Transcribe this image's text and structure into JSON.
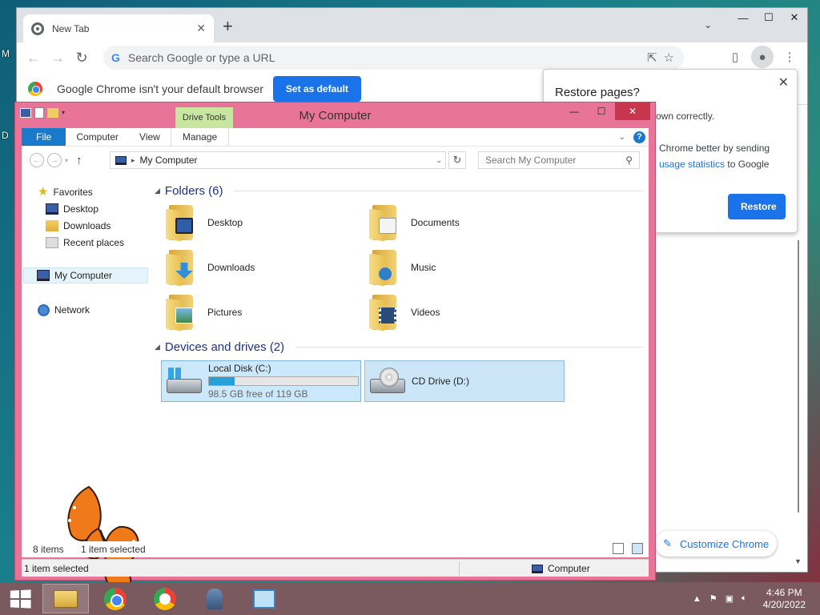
{
  "desktop": {
    "labels": [
      "M",
      "D"
    ]
  },
  "chrome": {
    "tab_title": "New Tab",
    "tab_close": "✕",
    "new_tab": "+",
    "tabstrip_menu": "⌄",
    "window_controls": [
      "—",
      "☐",
      "✕"
    ],
    "omnibox_g": "G",
    "omnibox_placeholder": "Search Google or type a URL",
    "infobar_message": "Google Chrome isn't your default browser",
    "set_default_label": "Set as default",
    "restore_popup": {
      "title": "Restore pages?",
      "close": "✕",
      "body_line1": "own correctly.",
      "body_line2a": "Chrome better by sending",
      "body_line2b_link": "usage statistics",
      "body_line2c": " to Google",
      "restore_label": "Restore"
    },
    "customize_label": "Customize Chrome"
  },
  "explorer": {
    "title": "My Computer",
    "context_tab": "Drive Tools",
    "ribbon_tabs": [
      "File",
      "Computer",
      "View",
      "Manage"
    ],
    "window_controls": [
      "—",
      "☐",
      "✕"
    ],
    "address_path": "My Computer",
    "search_placeholder": "Search My Computer",
    "nav_pane": {
      "favorites": "Favorites",
      "desktop": "Desktop",
      "downloads": "Downloads",
      "recent": "Recent places",
      "my_computer": "My Computer",
      "network": "Network"
    },
    "folders_header": "Folders (6)",
    "folders": [
      "Desktop",
      "Documents",
      "Downloads",
      "Music",
      "Pictures",
      "Videos"
    ],
    "devices_header": "Devices and drives (2)",
    "drives": {
      "c_name": "Local Disk (C:)",
      "c_free": "98.5 GB free of 119 GB",
      "c_used_fraction": 0.17,
      "d_name": "CD Drive (D:)"
    },
    "status_items": "8 items",
    "status_selected": "1 item selected",
    "statusbar_left": "1 item selected",
    "statusbar_right": "Computer"
  },
  "taskbar": {
    "time": "4:46 PM",
    "date": "4/20/2022"
  }
}
